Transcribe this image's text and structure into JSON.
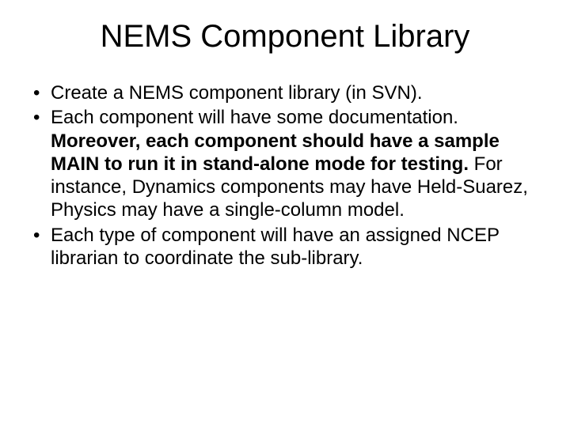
{
  "title": "NEMS Component Library",
  "bullets": {
    "b1": "Create a NEMS component library (in SVN).",
    "b2_part1": "Each component will have some documentation. ",
    "b2_bold": "Moreover, each component should have a sample MAIN to run it in stand-alone mode for testing.",
    "b2_part2": " For instance, Dynamics components may have Held-Suarez, Physics may have a single-column model.",
    "b3": "Each type of component will have an assigned NCEP librarian to coordinate the sub-library."
  }
}
